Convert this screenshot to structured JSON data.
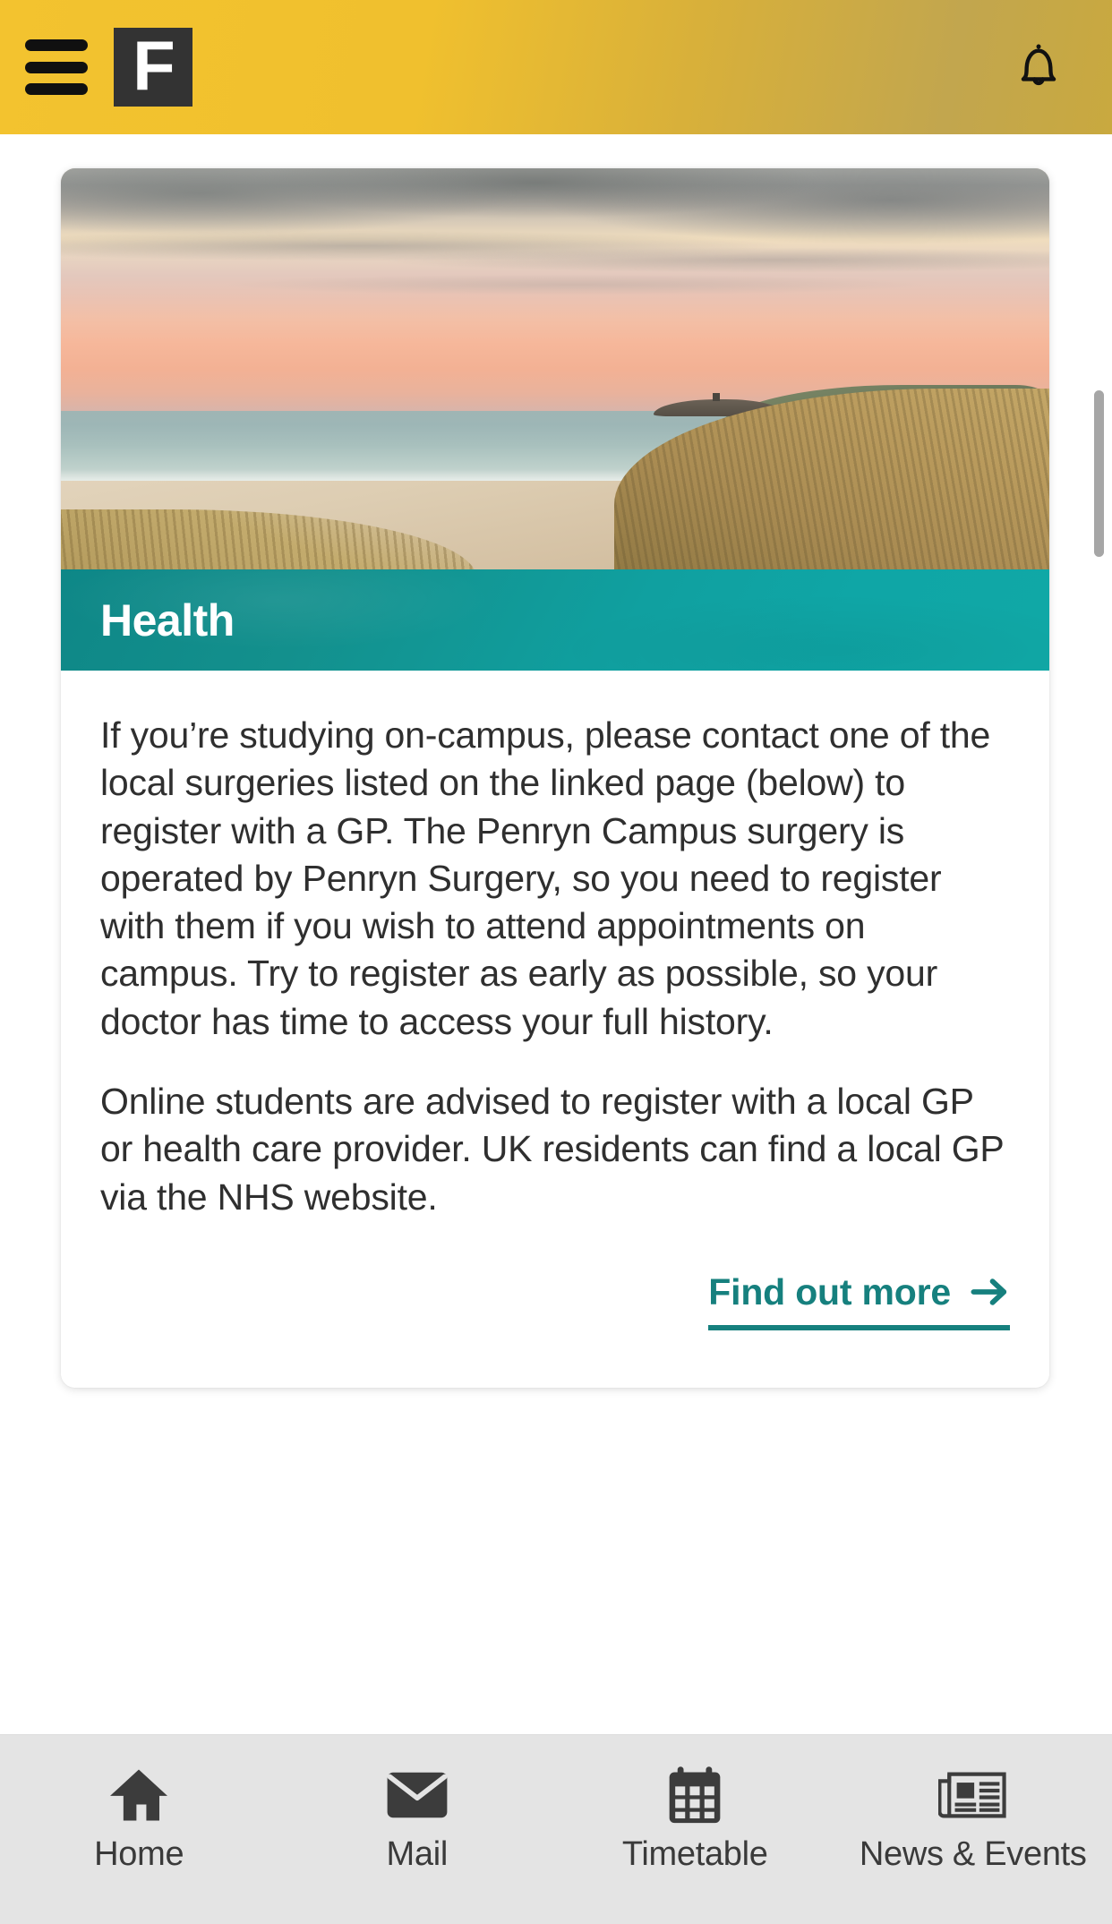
{
  "header": {
    "menu_icon": "hamburger-menu-icon",
    "logo_letter": "F",
    "logo_icon": "falmouth-logo",
    "notifications_icon": "bell-icon"
  },
  "card": {
    "hero_image_alt": "sunset-beach-coastline-photo",
    "title": "Health",
    "paragraphs": [
      "If you’re studying on-campus, please contact one of the local surgeries listed on the linked page (below) to register with a GP. The Penryn Campus surgery is operated by Penryn Surgery, so you need to register with them if you wish to attend appointments on campus. Try to register as early as possible, so your doctor has time to access your full history.",
      "Online students are advised to register with a local GP or health care provider. UK residents can find a local GP via the NHS website."
    ],
    "cta_label": "Find out more",
    "cta_icon": "arrow-right-icon"
  },
  "footer_nav": {
    "items": [
      {
        "label": "Home",
        "icon": "home-icon"
      },
      {
        "label": "Mail",
        "icon": "envelope-icon"
      },
      {
        "label": "Timetable",
        "icon": "calendar-icon"
      },
      {
        "label": "News & Events",
        "icon": "newspaper-icon"
      }
    ]
  },
  "colors": {
    "header_yellow": "#F3C32F",
    "header_yellow_end": "#C2A64E",
    "logo_dark": "#333333",
    "banner_teal_start": "#0E8787",
    "banner_teal_end": "#10A8A6",
    "cta_teal": "#16807E",
    "footer_gray": "#E4E4E4",
    "body_text": "#2F2F2F",
    "scrollbar_thumb": "#A6A6A6"
  }
}
